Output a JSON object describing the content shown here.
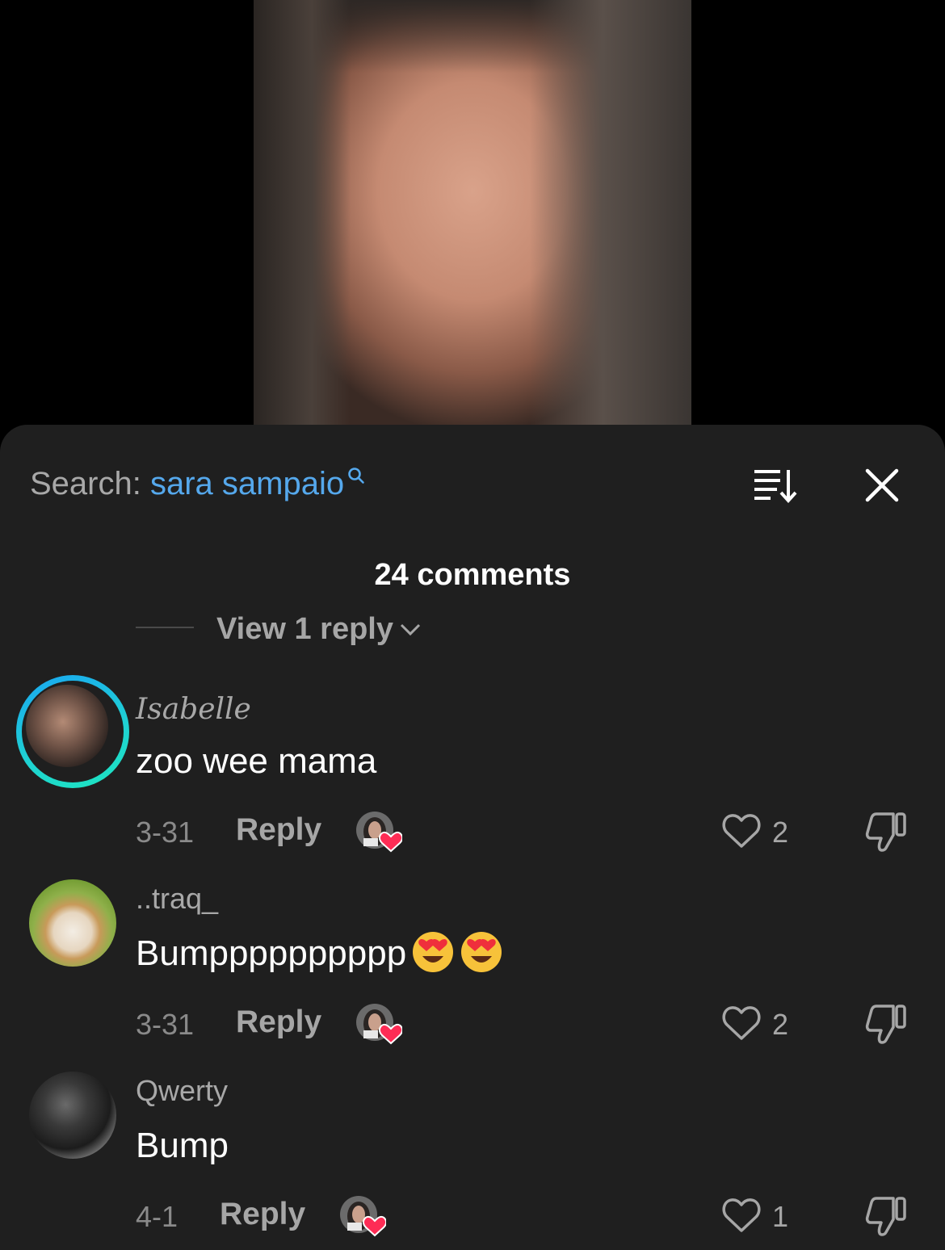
{
  "search": {
    "label": "Search: ",
    "query": "sara sampaio"
  },
  "header": {
    "count_label": "24 comments"
  },
  "thread": {
    "view_replies": "View 1 reply"
  },
  "comments": [
    {
      "username": "Isabelle",
      "text": "zoo wee mama",
      "date": "3-31",
      "reply": "Reply",
      "likes": "2"
    },
    {
      "username": "..traq_",
      "text": "Bumpppppppppp",
      "date": "3-31",
      "reply": "Reply",
      "likes": "2"
    },
    {
      "username": "Qwerty",
      "text": "Bump",
      "date": "4-1",
      "reply": "Reply",
      "likes": "1"
    }
  ],
  "colors": {
    "sheet": "#1f1f1f",
    "accent": "#55a8ec",
    "heart_red": "#fe2c55",
    "ring_start": "#1aa6f2",
    "ring_end": "#1de6c0"
  },
  "icons": [
    "search-icon",
    "sort-icon",
    "close-icon",
    "chevron-down-icon",
    "heart-icon",
    "dislike-icon",
    "creator-liked-icon",
    "heart-eyes-emoji"
  ]
}
